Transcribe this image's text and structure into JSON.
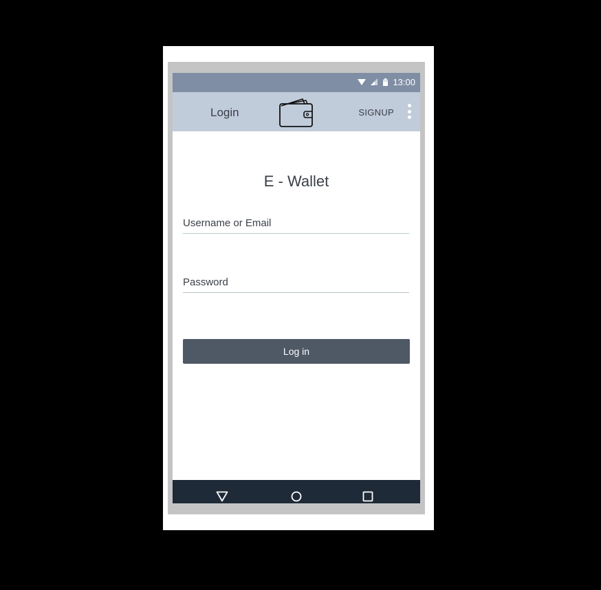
{
  "status_bar": {
    "time": "13:00",
    "icons": [
      "wifi-icon",
      "signal-icon",
      "battery-icon"
    ]
  },
  "app_bar": {
    "title": "Login",
    "logo_icon": "wallet-icon",
    "signup_label": "SIGNUP",
    "menu_icon": "overflow-menu-icon"
  },
  "form": {
    "heading": "E - Wallet",
    "username_placeholder": "Username or Email",
    "password_placeholder": "Password",
    "login_label": "Log in"
  },
  "nav_bar": {
    "icons": [
      "back-icon",
      "home-icon",
      "recents-icon"
    ]
  },
  "colors": {
    "status_bar": "#7f8ea4",
    "app_bar": "#c1ccdb",
    "button": "#4f5966",
    "nav_bar": "#1e2a38",
    "text": "#3a3f47"
  }
}
